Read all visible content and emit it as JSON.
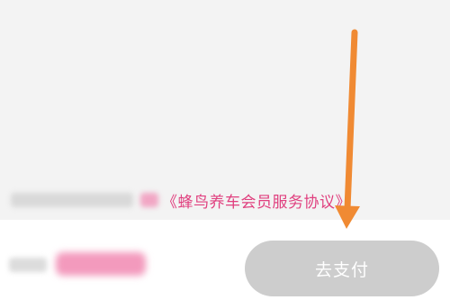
{
  "agreement": {
    "link_text": "《蜂鸟养车会员服务协议》"
  },
  "payment": {
    "button_label": "去支付"
  },
  "colors": {
    "accent_pink": "#e0407f",
    "button_disabled": "#cdcdcd",
    "arrow_annotation": "#f08a33"
  },
  "icons": {
    "annotation": "arrow-down-icon"
  }
}
